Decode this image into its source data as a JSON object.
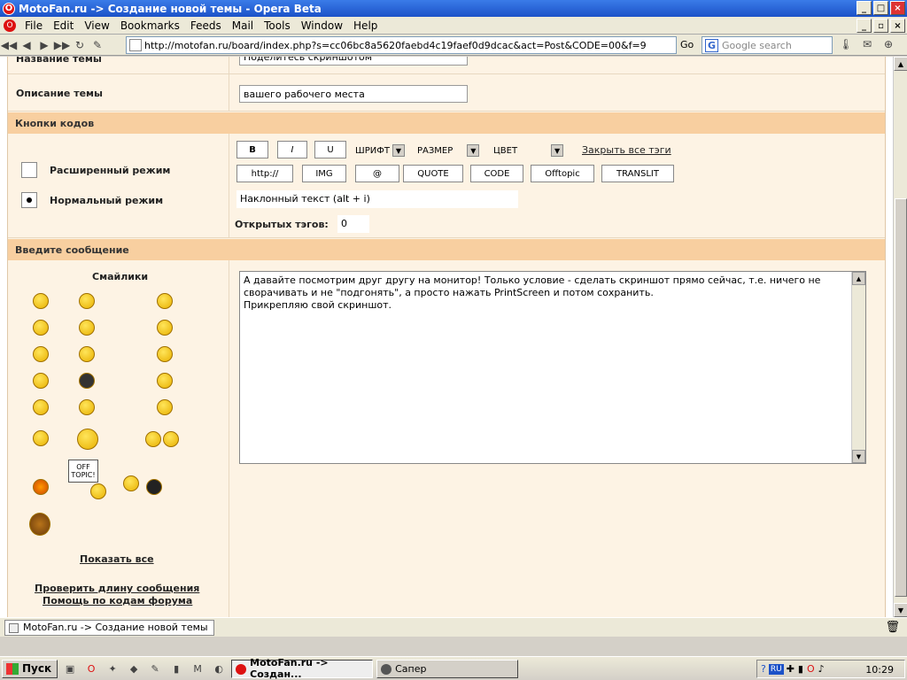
{
  "window": {
    "title": "MotoFan.ru -> Создание новой темы - Opera Beta"
  },
  "menu": [
    "File",
    "Edit",
    "View",
    "Bookmarks",
    "Feeds",
    "Mail",
    "Tools",
    "Window",
    "Help"
  ],
  "address": {
    "url": "http://motofan.ru/board/index.php?s=cc06bc8a5620faebd4c19faef0d9dcac&act=Post&CODE=00&f=9",
    "go": "Go"
  },
  "search": {
    "placeholder": "Google search"
  },
  "form": {
    "topic_title_label": "Название темы",
    "topic_title_value": "Поделитесь скриншотом",
    "topic_desc_label": "Описание темы",
    "topic_desc_value": "вашего рабочего места",
    "codes_header": "Кнопки кодов",
    "mode_extended": "Расширенный режим",
    "mode_normal": "Нормальный режим",
    "bold": "B",
    "italic": "I",
    "underline": "U",
    "font": "ШРИФТ",
    "size": "РАЗМЕР",
    "color": "ЦВЕТ",
    "close_tags": "Закрыть все тэги",
    "code_buttons": [
      "http://",
      "IMG",
      "@",
      "QUOTE",
      "CODE",
      "Offtopic",
      "TRANSLIT"
    ],
    "hint": "Наклонный текст (alt + i)",
    "open_tags_label": "Открытых тэгов:",
    "open_tags_value": "0",
    "message_header": "Введите сообщение",
    "smileys_title": "Смайлики",
    "offtopic_sign": "OFF TOPIC!",
    "show_all": "Показать все",
    "check_length": "Проверить длину сообщения",
    "help_codes": "Помощь по кодам форума",
    "message_text": "А давайте посмотрим друг другу на монитор! Только условие - сделать скриншот прямо сейчас, т.е. ничего не\nсворачивать и не \"подгонять\", а просто нажать PrintScreen и потом сохранить.\nПрикрепляю свой скриншот."
  },
  "statusbar": {
    "tab": "MotoFan.ru -> Создание новой темы"
  },
  "taskbar": {
    "start": "Пуск",
    "tasks": [
      "MotoFan.ru -> Создан...",
      "Сапер"
    ],
    "lang": "RU",
    "clock": "10:29"
  }
}
